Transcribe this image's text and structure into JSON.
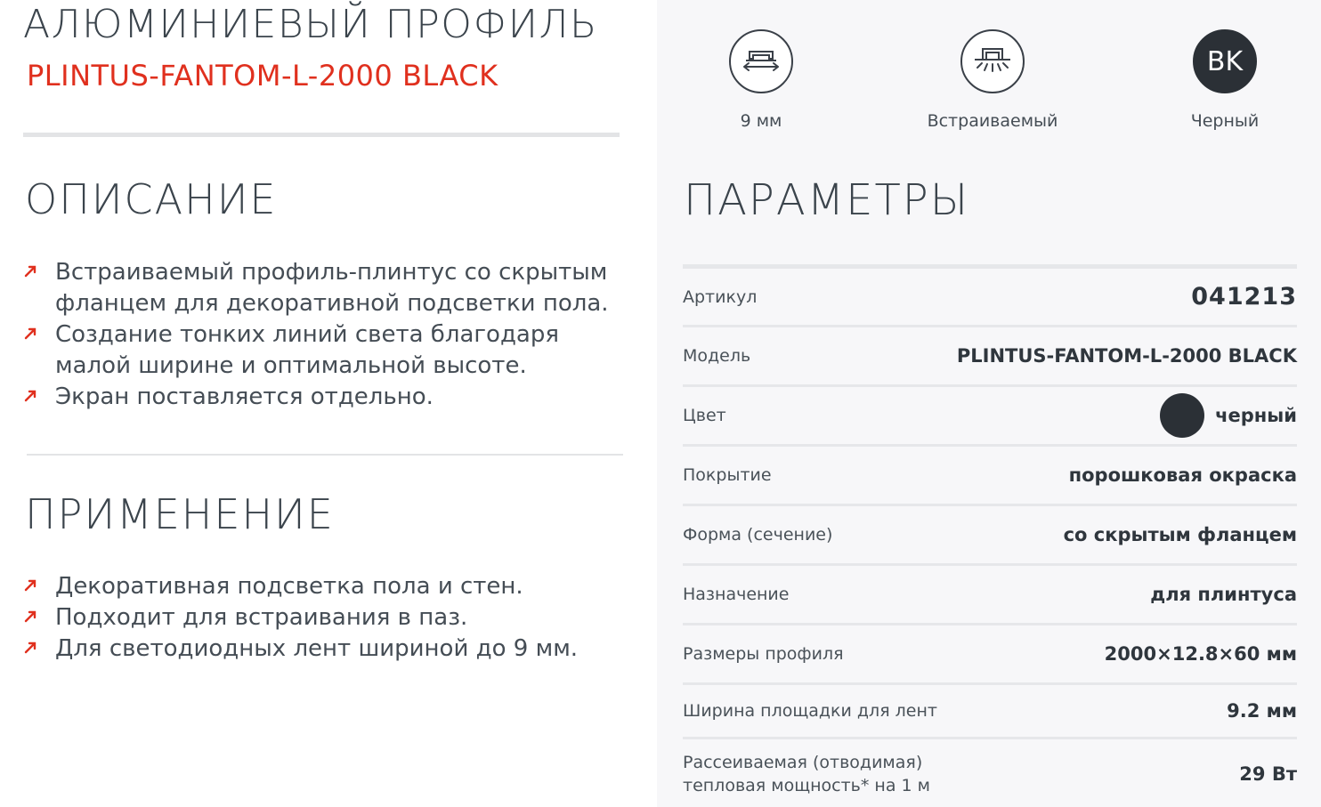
{
  "product": {
    "title": "АЛЮМИНИЕВЫЙ ПРОФИЛЬ",
    "model": "PLINTUS-FANTOM-L-2000 BLACK"
  },
  "description": {
    "heading": "ОПИСАНИЕ",
    "items": [
      "Встраиваемый профиль-плинтус со скрытым фланцем для декоративной подсветки пола.",
      "Создание тонких линий света благодаря малой ширине и оптимальной высоте.",
      "Экран поставляется отдельно."
    ]
  },
  "application": {
    "heading": "ПРИМЕНЕНИЕ",
    "items": [
      "Декоративная подсветка пола и стен.",
      "Подходит для встраивания в паз.",
      "Для светодиодных лент шириной до 9 мм."
    ]
  },
  "features": [
    {
      "icon": "width-arrow-icon",
      "label": "9 мм"
    },
    {
      "icon": "recessed-light-icon",
      "label": "Встраиваемый"
    },
    {
      "icon": "color-code-icon",
      "code": "BK",
      "label": "Черный"
    }
  ],
  "parameters": {
    "heading": "ПАРАМЕТРЫ",
    "rows": [
      {
        "label": "Артикул",
        "value": "041213"
      },
      {
        "label": "Модель",
        "value": "PLINTUS-FANTOM-L-2000 BLACK"
      },
      {
        "label": "Цвет",
        "value": "черный"
      },
      {
        "label": "Покрытие",
        "value": "порошковая окраска"
      },
      {
        "label": "Форма (сечение)",
        "value": "со скрытым фланцем"
      },
      {
        "label": "Назначение",
        "value": "для плинтуса"
      },
      {
        "label": "Размеры профиля",
        "value": "2000×12.8×60 мм"
      },
      {
        "label": "Ширина площадки для лент",
        "value": "9.2 мм"
      },
      {
        "label_line1": "Рассеиваемая (отводимая)",
        "label_line2": "тепловая мощность* на 1 м",
        "value": "29 Вт"
      }
    ]
  },
  "colors": {
    "accent": "#e0301e",
    "text": "#3b444c",
    "swatch_black": "#2b3036",
    "right_bg": "#f7f7f9"
  }
}
